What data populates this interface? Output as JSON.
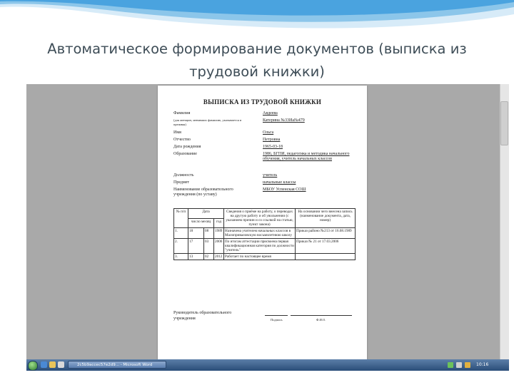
{
  "slide": {
    "title_line1": "Автоматическое формирование документов (выписка из",
    "title_line2": "трудовой книжки)"
  },
  "document": {
    "title": "ВЫПИСКА ИЗ ТРУДОВОЙ КНИЖКИ",
    "fields": [
      {
        "label": "Фамилия",
        "value": "Авдеева"
      },
      {
        "label": "(для женщин, менявших фамилию, указывается и прежняя)",
        "value": "Катерина №33Иа№479"
      },
      {
        "label": "Имя",
        "value": "Ольга"
      },
      {
        "label": "Отчество",
        "value": "Петровна"
      },
      {
        "label": "Дата рождения",
        "value": "1965-03-18"
      },
      {
        "label": "Образование",
        "value": "1986, БГПИ, педагогика и методика начального обучения, учитель начальных классов"
      },
      {
        "label": "Должность",
        "value": "учитель"
      },
      {
        "label": "Предмет",
        "value": "начальные классы"
      },
      {
        "label": "Наименование образовательного учреждения (по уставу)",
        "value": "МБОУ Успенская СОШ"
      }
    ],
    "table": {
      "headers": {
        "num": "№ п/п",
        "date": "Дата",
        "day_month": "число месяц",
        "year": "год",
        "info": "Сведения о приёме на работу, о переводах на другую работу и об увольнении (с указанием причин и со ссылкой на статью, пункт закона)",
        "basis": "На основании чего внесена запись (наименование документа, дата, номер)"
      },
      "rows": [
        {
          "num": "1.",
          "day": "18",
          "month": "08",
          "year": "1989",
          "info": "Назначена учителем начальных классов в Малоприваловскую восьмилетнюю школу",
          "basis": "Приказ районо №213 от 16.08.1989"
        },
        {
          "num": "2.",
          "day": "17",
          "month": "03",
          "year": "2006",
          "info": "По итогам аттестации присвоена первая квалификационная категория по должности \"учитель\"",
          "basis": "Приказ № 21 от 17.03.2006"
        },
        {
          "num": "3.",
          "day": "13",
          "month": "02",
          "year": "2012",
          "info": "Работает по настоящее время",
          "basis": ""
        }
      ]
    },
    "signature": {
      "label": "Руководитель образовательного учреждения",
      "caption_sign": "Подпись",
      "caption_name": "Ф.И.О."
    }
  },
  "taskbar": {
    "task_label": "2c5b9accec57e2d9... - Microsoft Word",
    "clock": "10:16"
  },
  "colors": {
    "swoosh": "#4aa3df",
    "title_text": "#3e4d57",
    "taskbar": "#2a4d78",
    "viewer_bg": "#a9a9a9"
  }
}
